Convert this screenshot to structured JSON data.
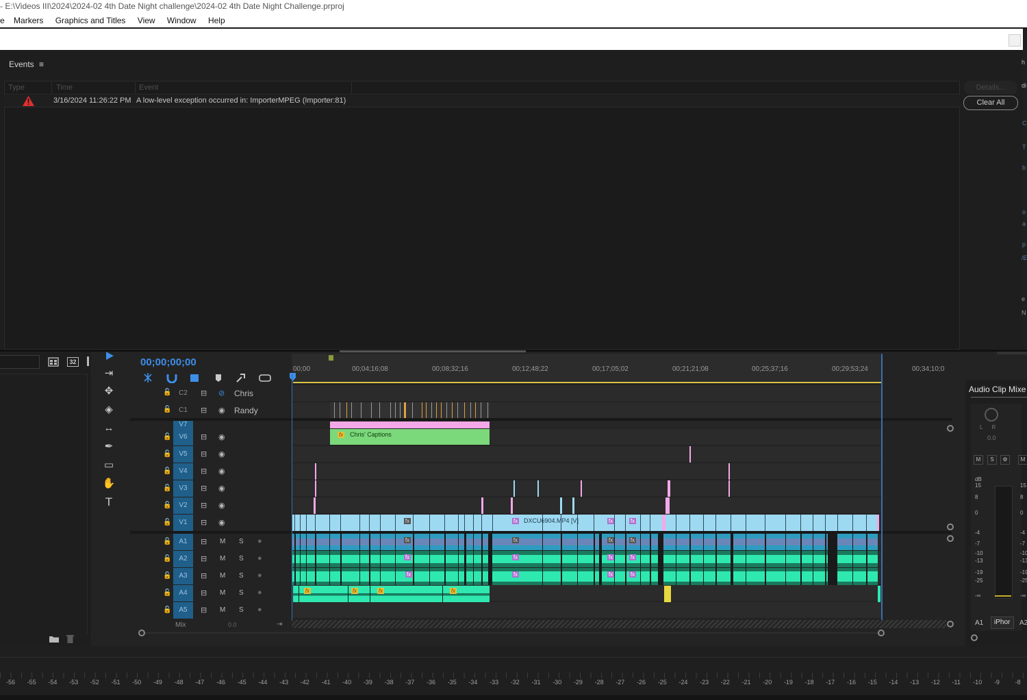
{
  "window": {
    "title": "E:\\Videos III\\2024\\2024-02 4th Date Night challenge\\2024-02 4th Date Night Challenge.prproj",
    "title_prefix": "-",
    "menu": [
      "Markers",
      "Graphics and Titles",
      "View",
      "Window",
      "Help"
    ],
    "menu_lead": "e"
  },
  "events": {
    "panel_title": "Events",
    "menu_glyph": "≡",
    "columns": [
      "Type",
      "Time",
      "Event"
    ],
    "rows": [
      {
        "type": "error",
        "time": "3/16/2024 11:26:22 PM",
        "event": "A low-level exception occurred in: ImporterMPEG (Importer:81)"
      }
    ],
    "buttons": {
      "details": "Details...",
      "clear_all": "Clear All"
    }
  },
  "project": {
    "icons": [
      "list-icon",
      "calendar-icon",
      "new-bin-icon",
      "delete-icon"
    ],
    "calendar_num": "32"
  },
  "timeline": {
    "timecode": "00;00;00;00",
    "ruler": [
      "00;00",
      "00;04;16;08",
      "00;08;32;16",
      "00;12;48;22",
      "00;17;05;02",
      "00;21;21;08",
      "00;25;37;16",
      "00;29;53;24",
      "00;34;10;0"
    ],
    "caption_tracks": [
      {
        "id": "C2",
        "name": "Chris"
      },
      {
        "id": "C1",
        "name": "Randy"
      }
    ],
    "video_tracks": [
      "V7",
      "V6",
      "V5",
      "V4",
      "V3",
      "V2",
      "V1"
    ],
    "audio_tracks": [
      "A1",
      "A2",
      "A3",
      "A4",
      "A5"
    ],
    "audio_buttons": {
      "mute": "M",
      "solo": "S"
    },
    "mix_label": "Mix",
    "mix_value": "0.0",
    "clips": {
      "captions_clip": "Chris' Captions",
      "v1_clip": "DXCU6904.MP4 [V]"
    }
  },
  "mixer": {
    "title": "Audio Clip Mixe",
    "pan": "L      R",
    "value": "0.0",
    "buttons": [
      "M",
      "S",
      "⚙",
      "M"
    ],
    "db_label": "dB",
    "scale": [
      "15",
      "8",
      "0",
      "-4",
      "-7",
      "-10",
      "-13",
      "-19",
      "-25",
      "-∞"
    ],
    "scale_right": [
      "15",
      "8",
      "0",
      "-4",
      "-7",
      "-10",
      "-13",
      "-19",
      "-25",
      "-∞"
    ],
    "channels": [
      "A1",
      "iPhor",
      "A2"
    ]
  },
  "bottom_ruler": [
    "-56",
    "-55",
    "-54",
    "-53",
    "-52",
    "-51",
    "-50",
    "-49",
    "-48",
    "-47",
    "-46",
    "-45",
    "-44",
    "-43",
    "-42",
    "-41",
    "-40",
    "-39",
    "-38",
    "-37",
    "-36",
    "-35",
    "-34",
    "-33",
    "-32",
    "-31",
    "-30",
    "-29",
    "-28",
    "-27",
    "-26",
    "-25",
    "-24",
    "-23",
    "-22",
    "-21",
    "-20",
    "-19",
    "-18",
    "-17",
    "-16",
    "-15",
    "-14",
    "-13",
    "-12",
    "-11",
    "-10",
    "-9",
    "-8"
  ],
  "right_strip_text": [
    "h",
    "di",
    "C",
    "T",
    "b",
    "o",
    "a",
    "p",
    "/E",
    "e",
    "N"
  ],
  "colors": {
    "accent": "#3d8ee8",
    "track_label": "#1f5f8a",
    "video_clip": "#9ed9f2",
    "audio_clip": "#2ecc9a",
    "caption_clip": "#7bd87b",
    "pink": "#f4a8e8",
    "error": "#e03030"
  }
}
